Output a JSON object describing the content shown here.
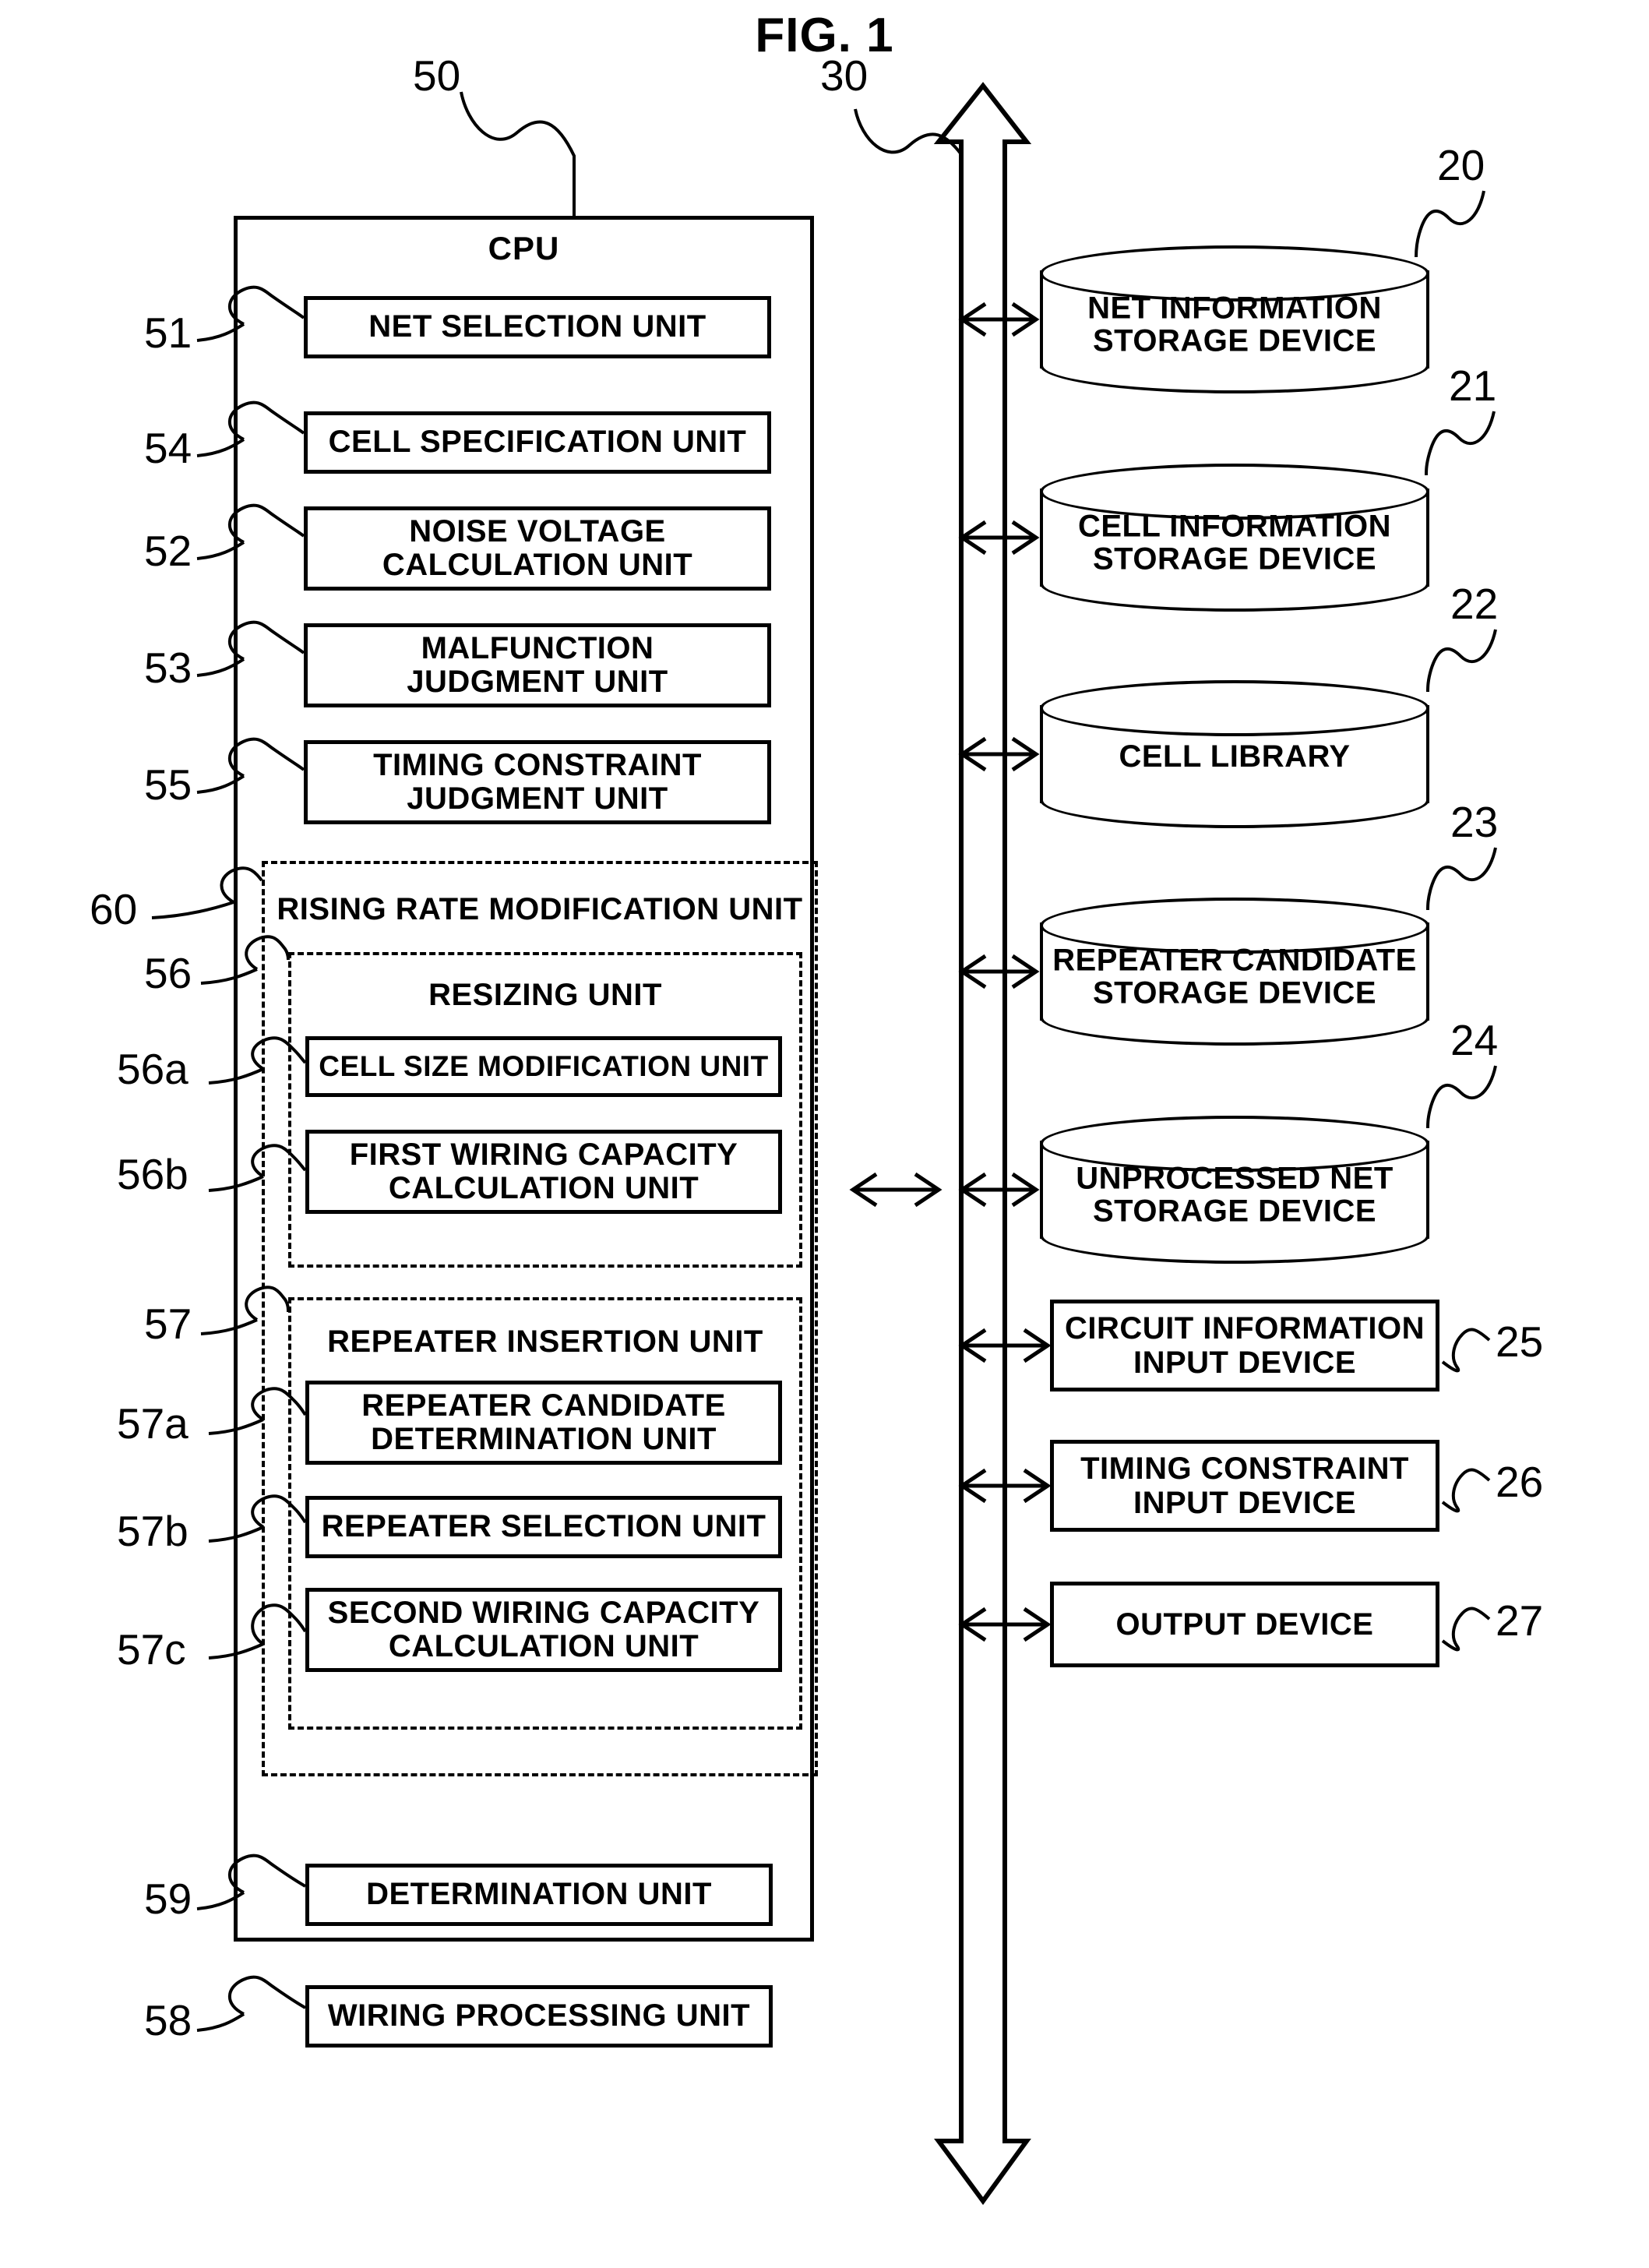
{
  "figure": {
    "title": "FIG. 1",
    "cpu": {
      "ref": "50",
      "label": "CPU",
      "units": [
        {
          "ref": "51",
          "label": "NET SELECTION UNIT"
        },
        {
          "ref": "54",
          "label": "CELL SPECIFICATION UNIT"
        },
        {
          "ref": "52",
          "label": "NOISE VOLTAGE\nCALCULATION UNIT"
        },
        {
          "ref": "53",
          "label": "MALFUNCTION\nJUDGMENT UNIT"
        },
        {
          "ref": "55",
          "label": "TIMING CONSTRAINT\nJUDGMENT UNIT"
        }
      ],
      "rising_rate_modification_unit": {
        "ref": "60",
        "label": "RISING RATE MODIFICATION UNIT",
        "resizing_unit": {
          "ref": "56",
          "label": "RESIZING UNIT",
          "units": [
            {
              "ref": "56a",
              "label": "CELL SIZE MODIFICATION UNIT"
            },
            {
              "ref": "56b",
              "label": "FIRST WIRING CAPACITY\nCALCULATION UNIT"
            }
          ]
        },
        "repeater_insertion_unit": {
          "ref": "57",
          "label": "REPEATER INSERTION UNIT",
          "units": [
            {
              "ref": "57a",
              "label": "REPEATER CANDIDATE\nDETERMINATION UNIT"
            },
            {
              "ref": "57b",
              "label": "REPEATER SELECTION UNIT"
            },
            {
              "ref": "57c",
              "label": "SECOND WIRING CAPACITY\nCALCULATION UNIT"
            }
          ]
        }
      },
      "bottom_units": [
        {
          "ref": "59",
          "label": "DETERMINATION UNIT"
        },
        {
          "ref": "58",
          "label": "WIRING PROCESSING UNIT"
        }
      ]
    },
    "bus": {
      "ref": "30"
    },
    "peripherals": [
      {
        "ref": "20",
        "kind": "cylinder",
        "label": "NET INFORMATION\nSTORAGE DEVICE"
      },
      {
        "ref": "21",
        "kind": "cylinder",
        "label": "CELL INFORMATION\nSTORAGE DEVICE"
      },
      {
        "ref": "22",
        "kind": "cylinder",
        "label": "CELL LIBRARY"
      },
      {
        "ref": "23",
        "kind": "cylinder",
        "label": "REPEATER CANDIDATE\nSTORAGE DEVICE"
      },
      {
        "ref": "24",
        "kind": "cylinder",
        "label": "UNPROCESSED NET\nSTORAGE DEVICE"
      },
      {
        "ref": "25",
        "kind": "box",
        "label": "CIRCUIT INFORMATION\nINPUT DEVICE"
      },
      {
        "ref": "26",
        "kind": "box",
        "label": "TIMING CONSTRAINT\nINPUT DEVICE"
      },
      {
        "ref": "27",
        "kind": "box",
        "label": "OUTPUT DEVICE"
      }
    ]
  }
}
